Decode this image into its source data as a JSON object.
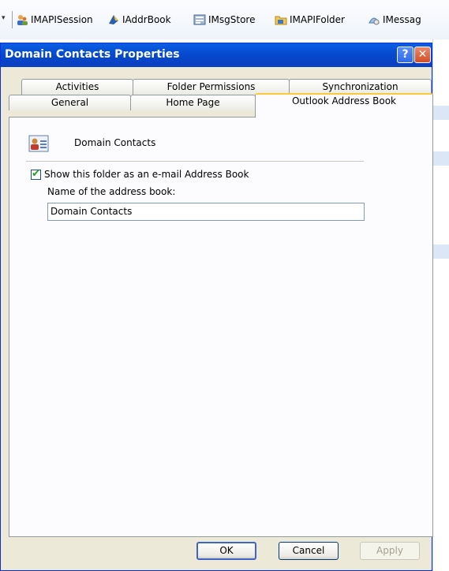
{
  "toolbar": {
    "items": [
      {
        "label": "IMAPISession",
        "icon": "session-icon"
      },
      {
        "label": "IAddrBook",
        "icon": "addrbook-icon"
      },
      {
        "label": "IMsgStore",
        "icon": "msgstore-icon"
      },
      {
        "label": "IMAPIFolder",
        "icon": "folder-icon"
      },
      {
        "label": "IMessag",
        "icon": "message-icon"
      }
    ],
    "overflow_glyph": "▾"
  },
  "dialog": {
    "title": "Domain Contacts Properties",
    "help_glyph": "?",
    "close_glyph": "✕",
    "tabs_back": [
      "Activities",
      "Folder Permissions",
      "Synchronization"
    ],
    "tabs_front": [
      "General",
      "Home Page",
      "Outlook Address Book"
    ],
    "active_tab": "Outlook Address Book",
    "folder_name": "Domain Contacts",
    "show_as_address_book": {
      "checked": true,
      "label": "Show this folder as an e-mail Address Book"
    },
    "address_book_name": {
      "label": "Name of the address book:",
      "value": "Domain Contacts"
    },
    "buttons": {
      "ok": "OK",
      "cancel": "Cancel",
      "apply": "Apply"
    }
  },
  "colors": {
    "titlebar": "#0548cc",
    "dialog_bg": "#ece9d8",
    "active_tab_accent": "#ffc83c"
  }
}
